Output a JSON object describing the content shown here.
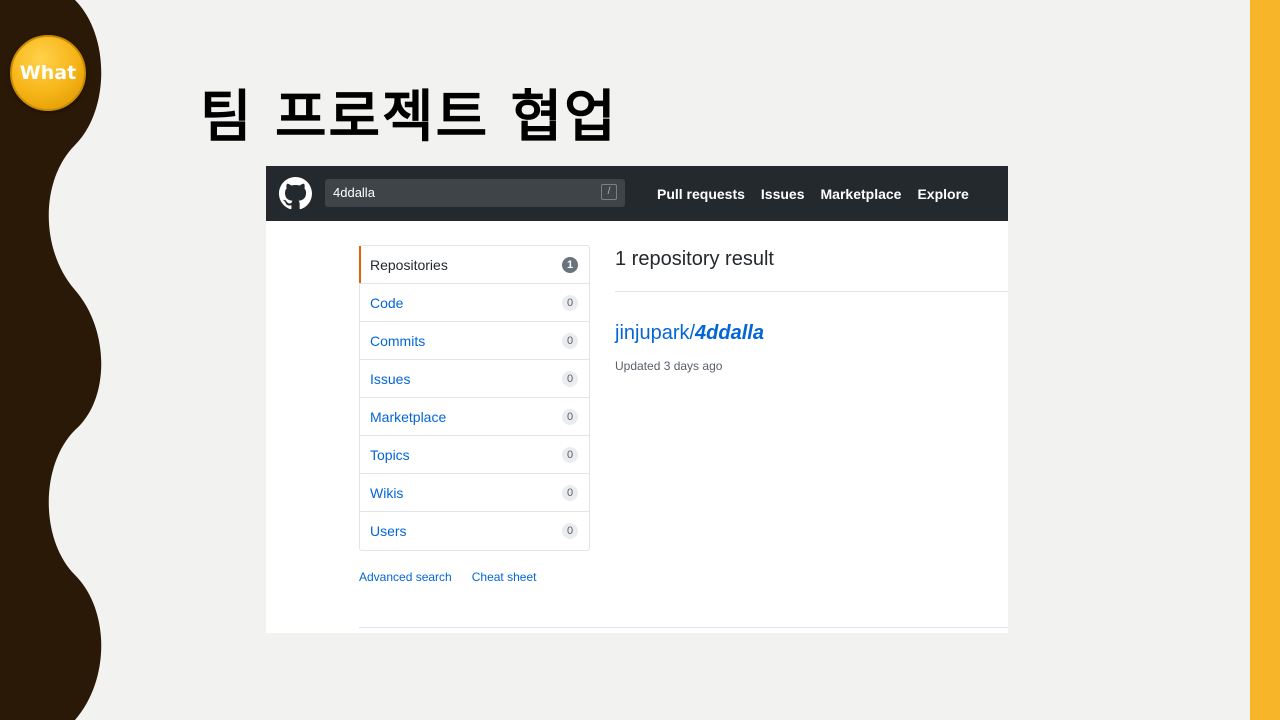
{
  "slide": {
    "badge_label": "What",
    "title": "팀 프로젝트 협업",
    "colors": {
      "left_band": "#2a1906",
      "right_band": "#f7b52a",
      "badge": "#f6b316"
    }
  },
  "github": {
    "logo_icon": "github-octocat-icon",
    "search": {
      "value": "4ddalla",
      "shortcut": "/"
    },
    "nav": [
      "Pull requests",
      "Issues",
      "Marketplace",
      "Explore"
    ],
    "sidebar": [
      {
        "label": "Repositories",
        "count": "1",
        "selected": true
      },
      {
        "label": "Code",
        "count": "0"
      },
      {
        "label": "Commits",
        "count": "0"
      },
      {
        "label": "Issues",
        "count": "0"
      },
      {
        "label": "Marketplace",
        "count": "0"
      },
      {
        "label": "Topics",
        "count": "0"
      },
      {
        "label": "Wikis",
        "count": "0"
      },
      {
        "label": "Users",
        "count": "0"
      }
    ],
    "footer_links": {
      "advanced_search": "Advanced search",
      "cheat_sheet": "Cheat sheet"
    },
    "results": {
      "heading": "1 repository result",
      "repo_owner": "jinjupark/",
      "repo_name": "4ddalla",
      "updated": "Updated 3 days ago"
    }
  }
}
